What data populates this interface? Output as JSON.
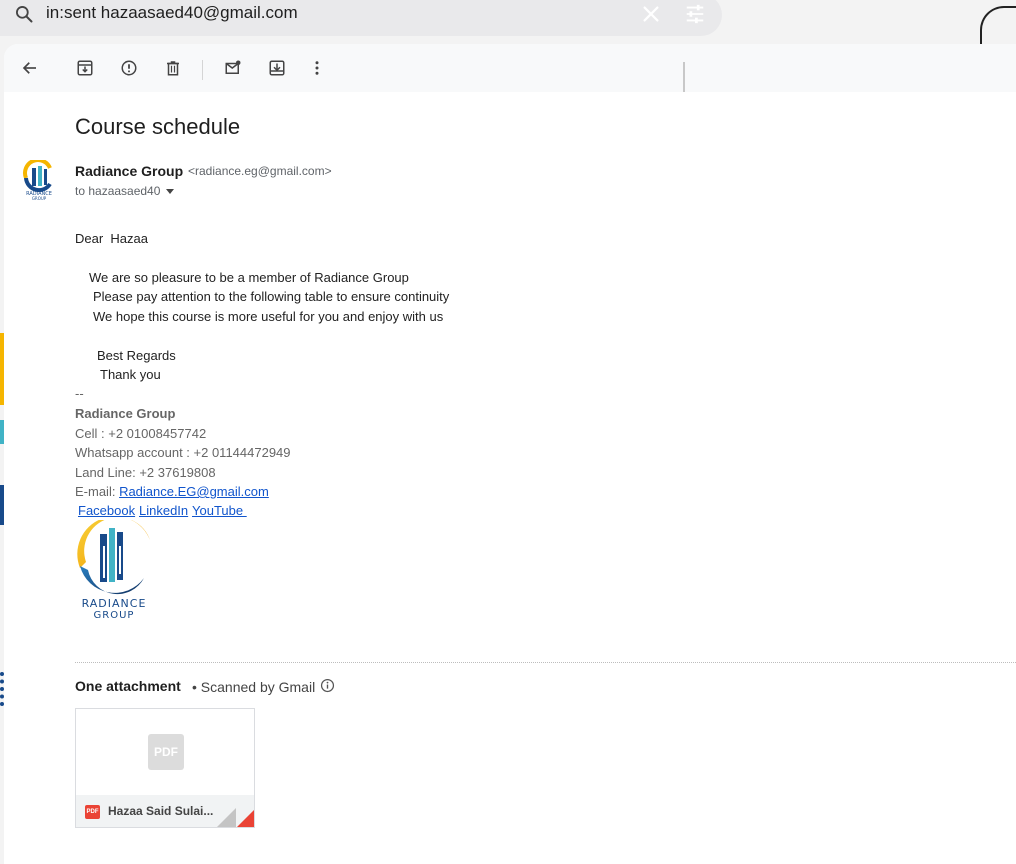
{
  "search": {
    "query": "in:sent hazaasaed40@gmail.com"
  },
  "icons": {
    "search": "search-icon",
    "clear": "close-icon",
    "tune": "tune-icon",
    "back": "arrow-back-icon",
    "archive": "archive-icon",
    "spam": "report-spam-icon",
    "delete": "trash-icon",
    "mark_unread": "mark-unread-icon",
    "move": "move-to-icon",
    "more": "more-vert-icon",
    "info": "info-icon",
    "pdf": "pdf-icon"
  },
  "email": {
    "subject": "Course schedule",
    "sender_name": "Radiance Group",
    "sender_email": "<radiance.eg@gmail.com>",
    "to": "to hazaasaed40",
    "body": {
      "greeting": "Dear  Hazaa",
      "line1": "We are so pleasure to be a member of Radiance Group",
      "line2": "Please pay attention to the following table to ensure continuity",
      "line3": "We hope this course is more useful for you and enjoy with us",
      "regards": "Best Regards",
      "thanks": "Thank you"
    },
    "signature": {
      "separator": "--",
      "name": "Radiance Group",
      "cell": "Cell : +2 01008457742",
      "whatsapp": "Whatsapp account : +2 01144472949",
      "landline": "Land Line: +2 37619808",
      "email_label": "E-mail: ",
      "email_link": "Radiance.EG@gmail.com",
      "facebook": "Facebook",
      "linkedin": "LinkedIn",
      "youtube": "YouTube "
    },
    "logo_text": "RADIANCE GROUP"
  },
  "attachments": {
    "title": "One attachment",
    "scan_note": "• Scanned by Gmail",
    "file_name": "Hazaa Said Sulai...",
    "preview_label": "PDF",
    "badge_label": "PDF"
  },
  "colors": {
    "link": "#1155cc",
    "pdf_red": "#ea4335",
    "logo_blue": "#184a8a",
    "logo_yellow": "#f5b500",
    "logo_teal": "#41b3c6"
  }
}
